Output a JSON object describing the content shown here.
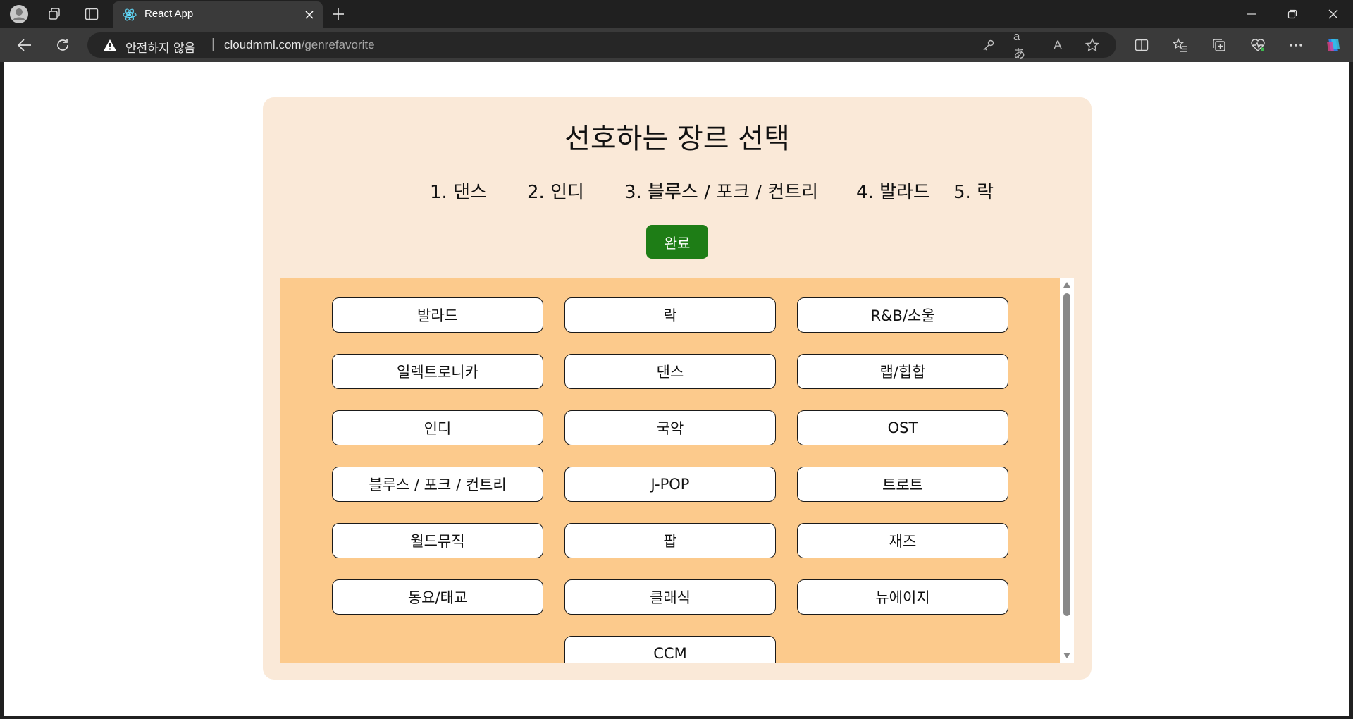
{
  "browser": {
    "tab_title": "React App",
    "security_label": "안전하지 않음",
    "url_host": "cloudmml.com",
    "url_path": "/genrefavorite",
    "read_aloud_glyph": "A",
    "translate_glyph": "aあ"
  },
  "page": {
    "title": "선호하는 장르 선택",
    "selected": [
      "1. 댄스",
      "2. 인디",
      "3. 블루스 / 포크 / 컨트리",
      "4. 발라드",
      "5. 락"
    ],
    "done_label": "완료",
    "genres": [
      "발라드",
      "락",
      "R&B/소울",
      "일렉트로니카",
      "댄스",
      "랩/힙합",
      "인디",
      "국악",
      "OST",
      "블루스 / 포크 / 컨트리",
      "J-POP",
      "트로트",
      "월드뮤직",
      "팝",
      "재즈",
      "동요/태교",
      "클래식",
      "뉴에이지",
      "CCM"
    ]
  },
  "colors": {
    "card_bg": "#fae9d8",
    "panel_bg": "#fcca8c",
    "done_button": "#1e7d16"
  }
}
